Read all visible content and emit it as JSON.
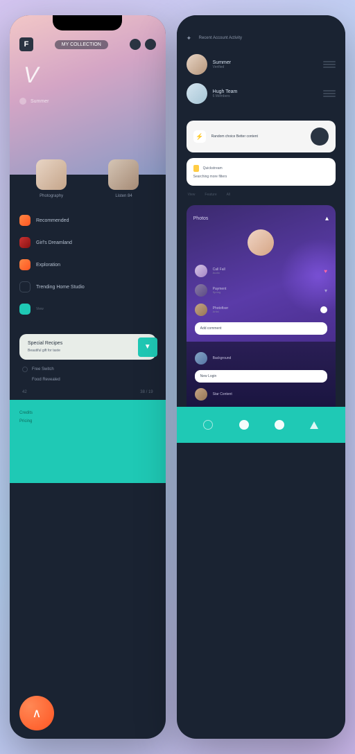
{
  "phoneLeft": {
    "logo": "F",
    "tab": "MY COLLECTION",
    "brandV": "V",
    "subtitle": "Summer",
    "avatars": [
      {
        "label": "Photography"
      },
      {
        "label": "Listen 84"
      }
    ],
    "list": [
      {
        "text": "Recommended",
        "sub": ""
      },
      {
        "text": "Girl's Dreamland"
      },
      {
        "text": "Exploration"
      },
      {
        "text": "Trending Home Studio",
        "sub": "View"
      }
    ],
    "card": {
      "title": "Special Recipes",
      "text": "Beautiful gift for taste"
    },
    "mini1": "Free Switch",
    "mini2": "Food Revealed",
    "num1": "42",
    "num2": "38 / 19",
    "footer": [
      "Credits",
      "Pricing"
    ],
    "fab": "∧"
  },
  "phoneRight": {
    "titleLines": "Recent Account Activity",
    "user1": {
      "name": "Summer",
      "sub": "Verified"
    },
    "user2": {
      "name": "Hugh Team",
      "sub": "6 Members"
    },
    "card1text": "Random choice\nBetter content",
    "card2": {
      "title": "Quickstream",
      "sub": "Searching more filters"
    },
    "sep": [
      "View",
      "Feature",
      "All"
    ],
    "purple": {
      "title": "Photos",
      "rows": [
        {
          "name": "Call Fall",
          "sub": "Audio"
        },
        {
          "name": "Payment",
          "sub": "Spring"
        },
        {
          "name": "Photofixer",
          "sub": "Artist"
        }
      ],
      "bubble": "Add comment"
    },
    "dark": {
      "rows": [
        {
          "name": "Background"
        },
        {
          "name": "New Login"
        },
        {
          "name": "Star Content"
        }
      ]
    }
  }
}
